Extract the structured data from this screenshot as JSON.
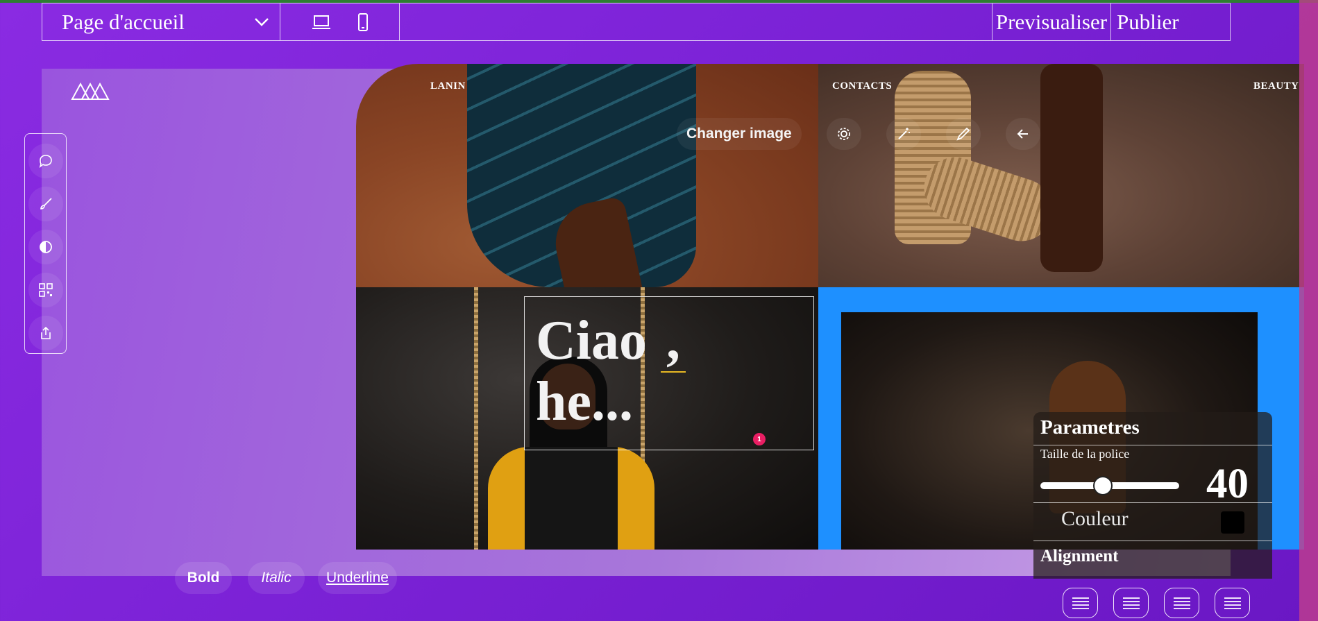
{
  "toolbar": {
    "page_select": "Page d'accueil",
    "preview_label": "Previsualiser",
    "publish_label": "Publier"
  },
  "site": {
    "nav": [
      "LANIN",
      "CONTACTS",
      "BEAUTY"
    ],
    "hero_line1": "Ciao",
    "hero_comma": ",",
    "hero_line2": "he...",
    "notification_count": "1"
  },
  "image_bar": {
    "change_image_label": "Changer image",
    "icons": [
      "gear-icon",
      "magic-wand-icon",
      "pencil-icon",
      "back-arrow-icon"
    ]
  },
  "left_tools": [
    "chat-icon",
    "brush-icon",
    "contrast-icon",
    "qr-code-icon",
    "share-icon"
  ],
  "format": {
    "bold": "Bold",
    "italic": "Italic",
    "underline": "Underline"
  },
  "params": {
    "title": "Parametres",
    "font_size_label": "Taille de la police",
    "font_size_value": "40",
    "font_size_fraction": 0.45,
    "color_label": "Couleur",
    "color_value": "#000000",
    "alignment_label": "Alignment",
    "align_icons": [
      "align-left-icon",
      "align-center-icon",
      "align-right-icon",
      "align-justify-icon"
    ]
  },
  "colors": {
    "background": "#7b22d6",
    "accent_blue": "#1e90ff",
    "notification": "#e91e63"
  }
}
